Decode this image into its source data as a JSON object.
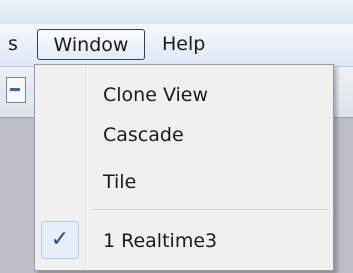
{
  "menubar": {
    "partial_label": "s",
    "window_label": "Window",
    "help_label": "Help"
  },
  "window_menu": {
    "items": [
      {
        "label": "Clone View"
      },
      {
        "label": "Cascade"
      },
      {
        "label": "Tile"
      },
      {
        "label": "1 Realtime3",
        "checked": true
      }
    ],
    "check_glyph": "✓"
  },
  "icons": {
    "checkmark": "checkmark-icon",
    "toolbar_button": "toolbar-tool-icon"
  },
  "colors": {
    "menu_background": "#f0f0f0",
    "menubar_background": "#dfe8f4",
    "active_menu_border": "#2e3e55",
    "check_highlight": "#e6eef9",
    "check_color": "#2a4b8f"
  }
}
